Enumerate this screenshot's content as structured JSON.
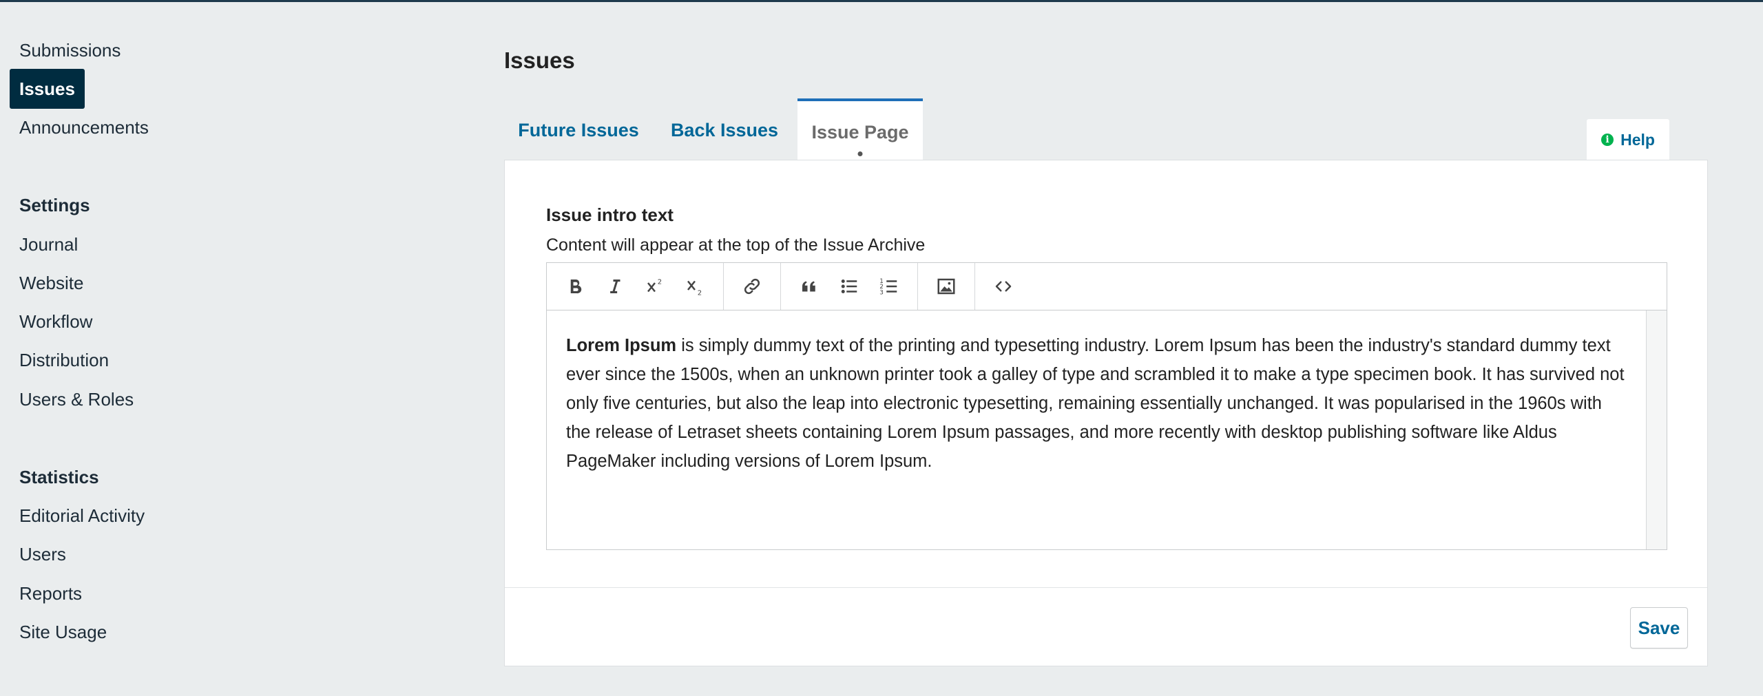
{
  "sidebar": {
    "items": [
      {
        "label": "Submissions"
      },
      {
        "label": "Issues",
        "active": true
      },
      {
        "label": "Announcements"
      }
    ],
    "settings_heading": "Settings",
    "settings_items": [
      {
        "label": "Journal"
      },
      {
        "label": "Website"
      },
      {
        "label": "Workflow"
      },
      {
        "label": "Distribution"
      },
      {
        "label": "Users & Roles"
      }
    ],
    "statistics_heading": "Statistics",
    "statistics_items": [
      {
        "label": "Editorial Activity"
      },
      {
        "label": "Users"
      },
      {
        "label": "Reports"
      },
      {
        "label": "Site Usage"
      }
    ]
  },
  "main": {
    "title": "Issues",
    "tabs": [
      {
        "label": "Future Issues"
      },
      {
        "label": "Back Issues"
      },
      {
        "label": "Issue Page",
        "active": true
      }
    ],
    "help_label": "Help",
    "field_label": "Issue intro text",
    "field_description": "Content will appear at the top of the Issue Archive",
    "editor": {
      "bold_lead": "Lorem Ipsum",
      "body": " is simply dummy text of the printing and typesetting industry. Lorem Ipsum has been the industry's standard dummy text ever since the 1500s, when an unknown printer took a galley of type and scrambled it to make a type specimen book. It has survived not only five centuries, but also the leap into electronic typesetting, remaining essentially unchanged. It was popularised in the 1960s with the release of Letraset sheets containing Lorem Ipsum passages, and more recently with desktop publishing software like Aldus PageMaker including versions of Lorem Ipsum."
    },
    "save_label": "Save"
  },
  "colors": {
    "accent": "#006798",
    "active_nav_bg": "#002c40",
    "help_icon": "#00b24e",
    "tab_border": "#1e6fb8"
  }
}
